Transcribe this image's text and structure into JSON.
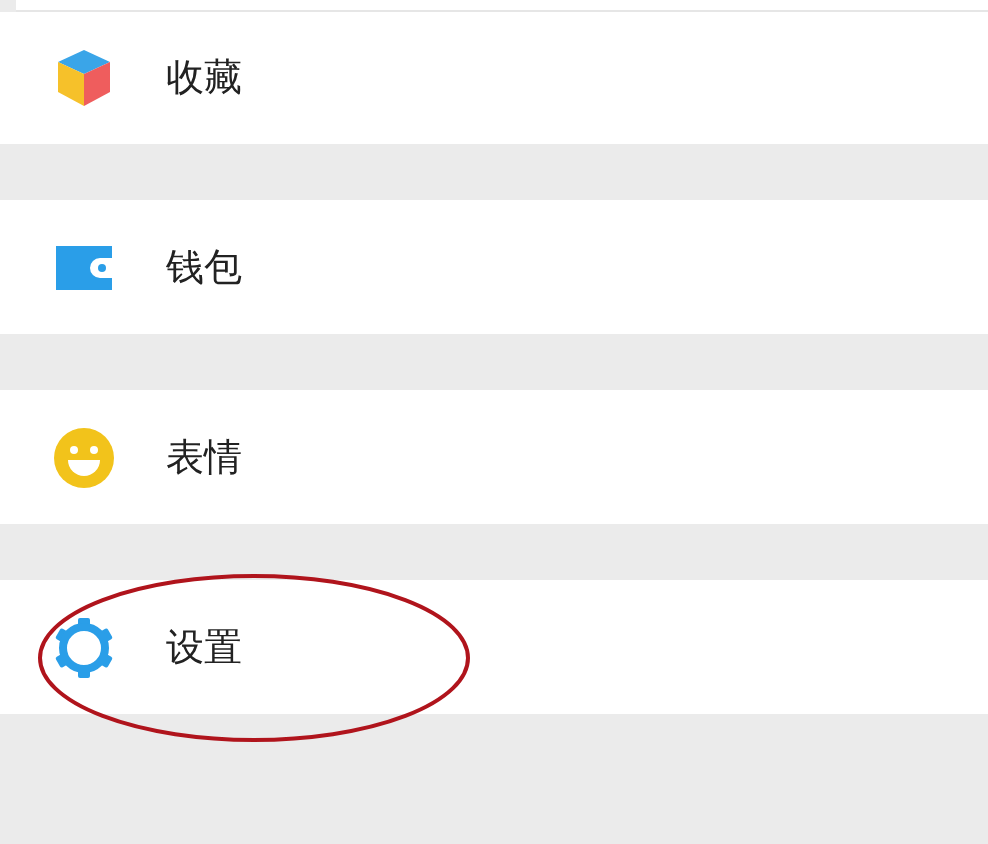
{
  "menu_items": [
    {
      "label": "收藏",
      "kind": "cube",
      "circled": false
    },
    {
      "label": "钱包",
      "kind": "wallet",
      "circled": false
    },
    {
      "label": "表情",
      "kind": "smiley",
      "circled": false
    },
    {
      "label": "设置",
      "kind": "gear",
      "circled": true
    }
  ]
}
